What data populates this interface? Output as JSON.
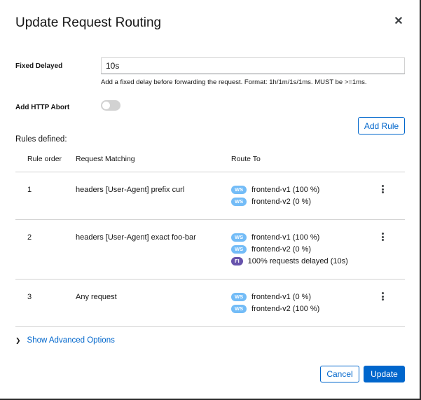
{
  "modal": {
    "title": "Update Request Routing",
    "close_glyph": "✕"
  },
  "fixed_delayed": {
    "label": "Fixed Delayed",
    "value": "10s",
    "helper": "Add a fixed delay before forwarding the request. Format: 1h/1m/1s/1ms. MUST be >=1ms."
  },
  "http_abort": {
    "label": "Add HTTP Abort",
    "enabled": false
  },
  "add_rule_label": "Add Rule",
  "rules": {
    "label": "Rules defined:",
    "headers": [
      "Rule order",
      "Request Matching",
      "Route To"
    ],
    "rows": [
      {
        "order": "1",
        "matching": "headers [User-Agent] prefix curl",
        "routes": [
          {
            "badge": "WS",
            "text": "frontend-v1 (100 %)"
          },
          {
            "badge": "WS",
            "text": "frontend-v2 (0 %)"
          }
        ]
      },
      {
        "order": "2",
        "matching": "headers [User-Agent] exact foo-bar",
        "routes": [
          {
            "badge": "WS",
            "text": "frontend-v1 (100 %)"
          },
          {
            "badge": "WS",
            "text": "frontend-v2 (0 %)"
          },
          {
            "badge": "FI",
            "text": "100% requests delayed (10s)"
          }
        ]
      },
      {
        "order": "3",
        "matching": "Any request",
        "routes": [
          {
            "badge": "WS",
            "text": "frontend-v1 (0 %)"
          },
          {
            "badge": "WS",
            "text": "frontend-v2 (100 %)"
          }
        ]
      }
    ]
  },
  "advanced_label": "Show Advanced Options",
  "footer": {
    "cancel_label": "Cancel",
    "update_label": "Update"
  },
  "colors": {
    "primary": "#0066cc",
    "ws_badge": "#73bcf7",
    "fi_badge": "#6753ac",
    "toggle_off": "#d2d2d2"
  },
  "icons": {
    "close": "close-icon",
    "kebab": "kebab-icon",
    "chevron": "chevron-right-icon"
  }
}
